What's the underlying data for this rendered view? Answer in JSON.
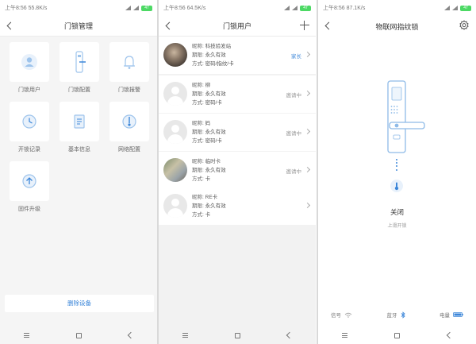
{
  "statusbar": {
    "p1_time": "上午8:56",
    "p1_speed": "55.8K/s",
    "p2_time": "上午8:56",
    "p2_speed": "64.5K/s",
    "p3_time": "上午8:56",
    "p3_speed": "87.1K/s",
    "battery": "47"
  },
  "lock_manage": {
    "title": "门锁管理",
    "tiles": [
      {
        "label": "门锁用户",
        "icon": "user-icon"
      },
      {
        "label": "门锁配置",
        "icon": "lock-config-icon"
      },
      {
        "label": "门锁报警",
        "icon": "bell-icon"
      },
      {
        "label": "开锁记录",
        "icon": "clock-icon"
      },
      {
        "label": "基本信息",
        "icon": "document-icon"
      },
      {
        "label": "网络配置",
        "icon": "network-icon"
      },
      {
        "label": "固件升级",
        "icon": "upgrade-icon"
      }
    ],
    "delete_button": "删除设备"
  },
  "lock_users": {
    "title": "门锁用户",
    "field_labels": {
      "name": "昵称:",
      "period": "期限:",
      "method": "方式:"
    },
    "users": [
      {
        "name": "科技验发站",
        "period": "永久有效",
        "method": "密码/指纹/卡",
        "tag": "家长",
        "avatar": "photo1"
      },
      {
        "name": "柳",
        "period": "永久有效",
        "method": "密码/卡",
        "tag": "邀请中",
        "avatar": "default"
      },
      {
        "name": "妈",
        "period": "永久有效",
        "method": "密码/卡",
        "tag": "邀请中",
        "avatar": "default"
      },
      {
        "name": "临时卡",
        "period": "永久有效",
        "method": "卡",
        "tag": "邀请中",
        "avatar": "photo2"
      },
      {
        "name": "RE卡",
        "period": "永久有效",
        "method": "卡",
        "tag": "",
        "avatar": "default"
      }
    ]
  },
  "fingerprint_lock": {
    "title": "物联网指纹锁",
    "state": "关闭",
    "last_operation": "上滑开锁",
    "footer": {
      "signal_label": "信号",
      "bluetooth_label": "蓝牙",
      "battery_label": "电量"
    }
  },
  "colors": {
    "accent": "#3b86d9",
    "icon_bg": "#e8f1fb"
  }
}
